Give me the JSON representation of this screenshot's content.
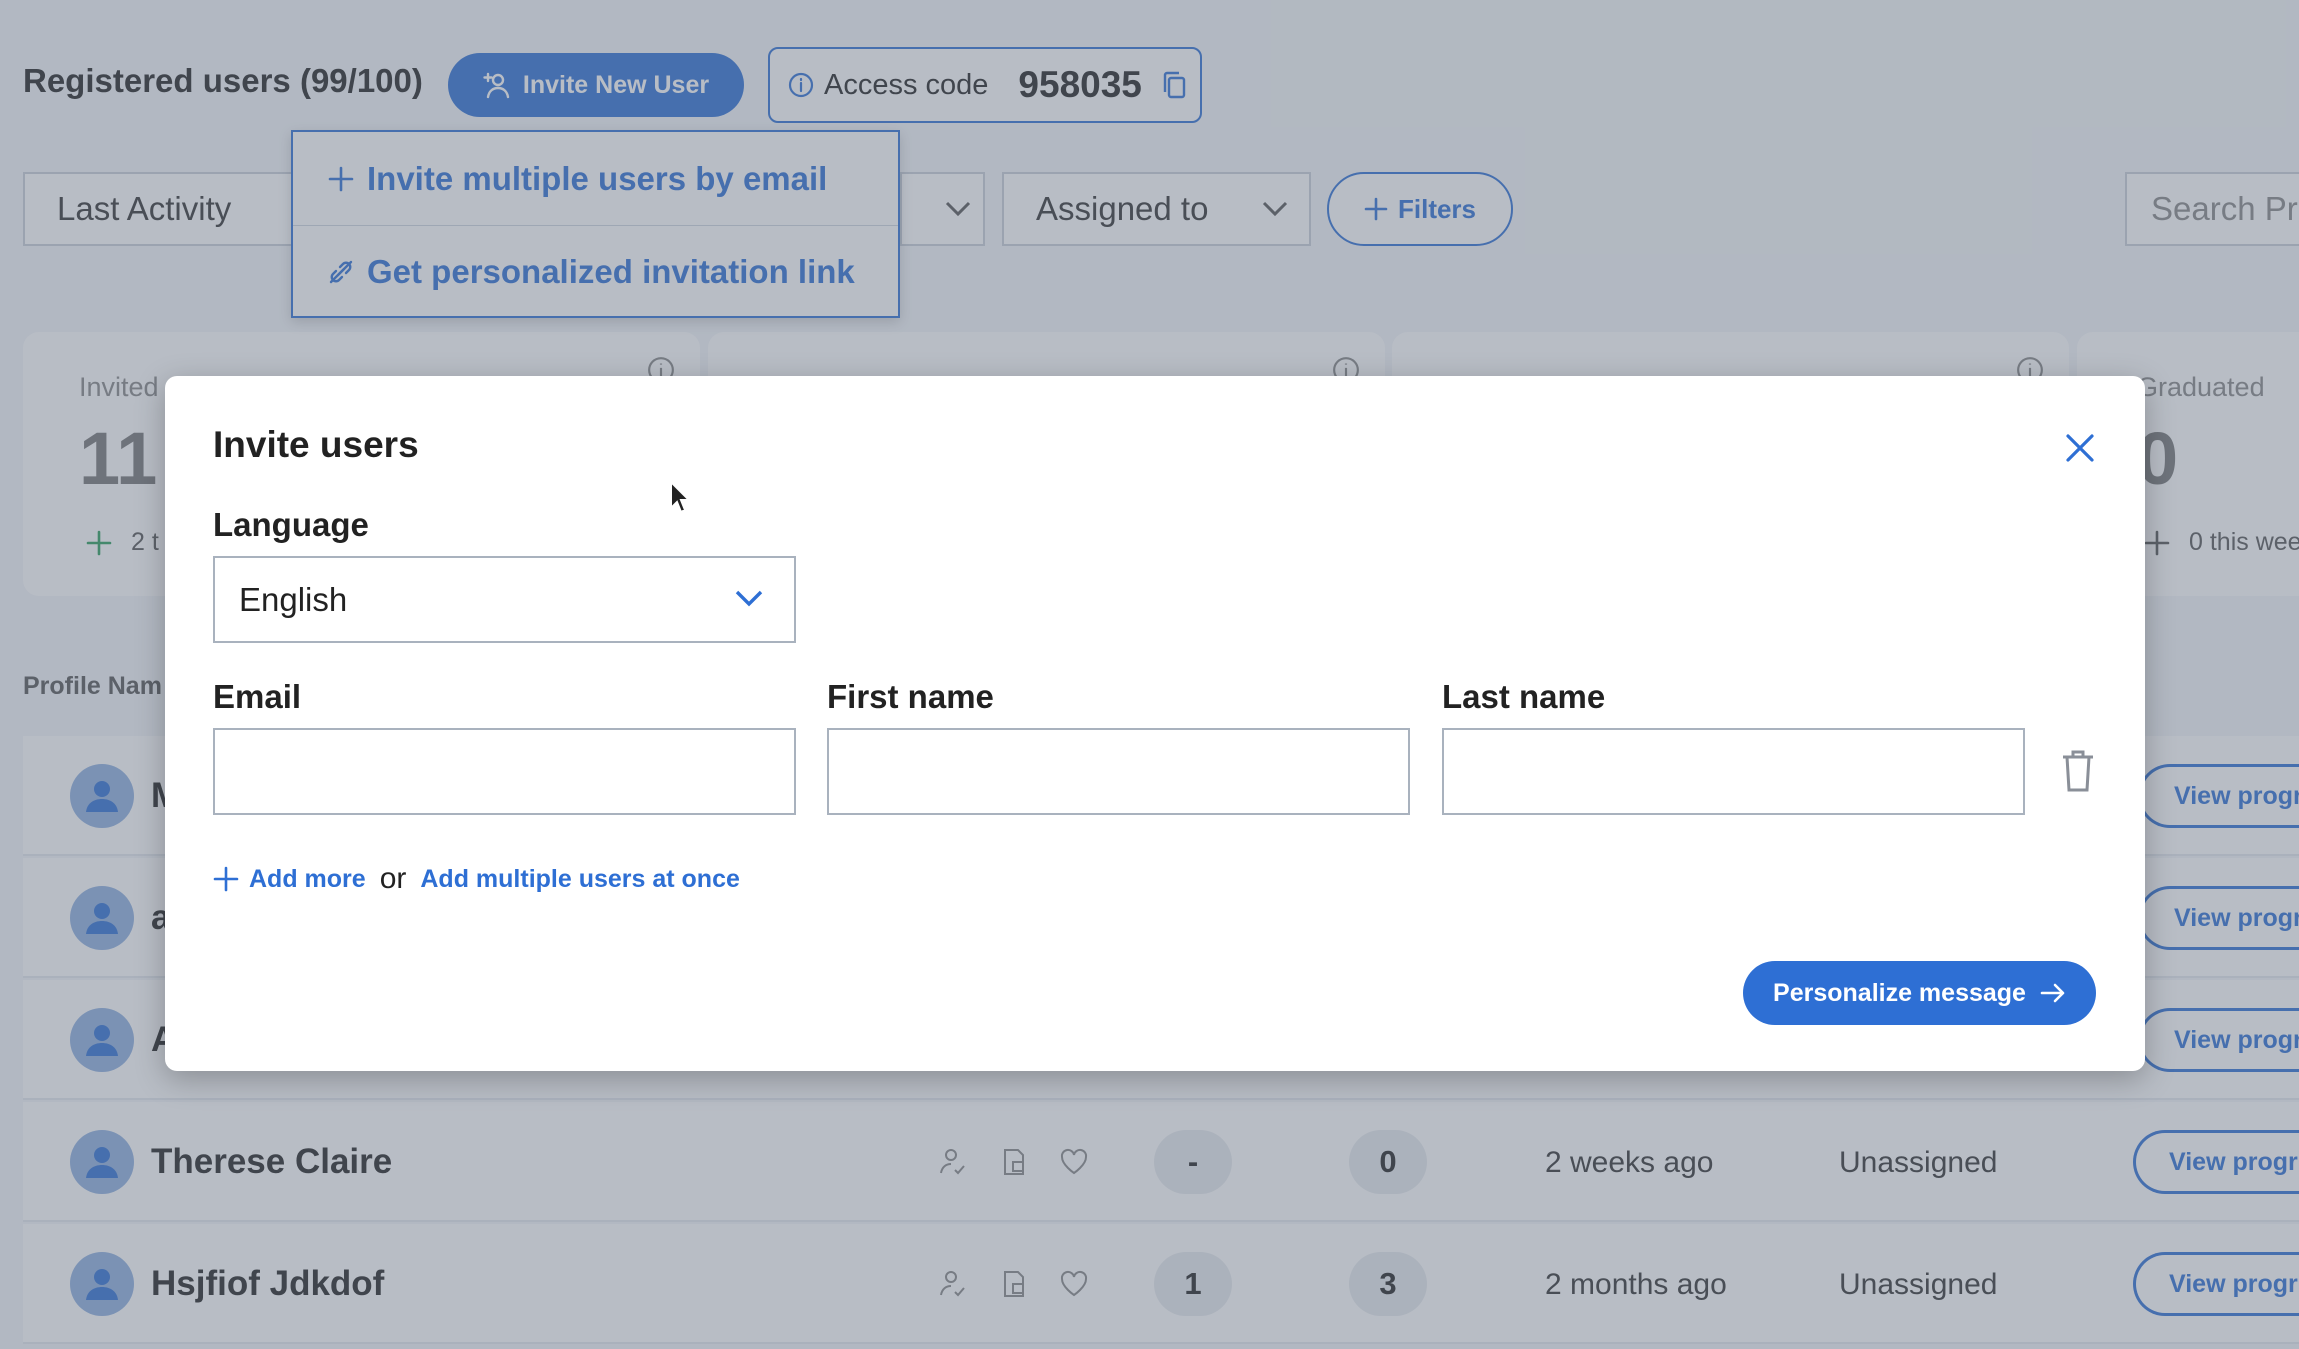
{
  "header": {
    "title": "Registered users (99/100)",
    "invite_button": "Invite New User",
    "access_label": "Access code",
    "access_code": "958035"
  },
  "invite_menu": {
    "items": [
      {
        "label": "Invite multiple users by email",
        "icon": "plus-icon"
      },
      {
        "label": "Get personalized invitation link",
        "icon": "link-icon"
      }
    ]
  },
  "filters": {
    "sort_value": "Last Activity",
    "assigned_value": "Assigned to",
    "filters_label": "Filters",
    "search_placeholder": "Search Pro"
  },
  "stats": {
    "invited_label": "Invited",
    "invited_value": "11",
    "invited_sub": "2 t",
    "graduated_label": "Graduated",
    "graduated_value": "0",
    "graduated_sub": "0 this wee"
  },
  "table": {
    "column_head": "Profile Nam",
    "view_label": "View progr",
    "rows": [
      {
        "name": "M"
      },
      {
        "name": "a"
      },
      {
        "name": "A"
      },
      {
        "name": "Therese Claire",
        "col_a": "-",
        "col_b": "0",
        "last_activity": "2 weeks ago",
        "assigned": "Unassigned"
      },
      {
        "name": "Hsjfiof Jdkdof",
        "col_a": "1",
        "col_b": "3",
        "last_activity": "2 months ago",
        "assigned": "Unassigned"
      }
    ]
  },
  "modal": {
    "title": "Invite users",
    "language_label": "Language",
    "language_value": "English",
    "email_label": "Email",
    "first_name_label": "First name",
    "last_name_label": "Last name",
    "email_value": "",
    "first_name_value": "",
    "last_name_value": "",
    "add_more": "Add more",
    "or": "or",
    "add_multiple": "Add multiple users at once",
    "personalize_button": "Personalize message"
  },
  "colors": {
    "accent": "#2e6fd4",
    "overlay": "#647080"
  }
}
